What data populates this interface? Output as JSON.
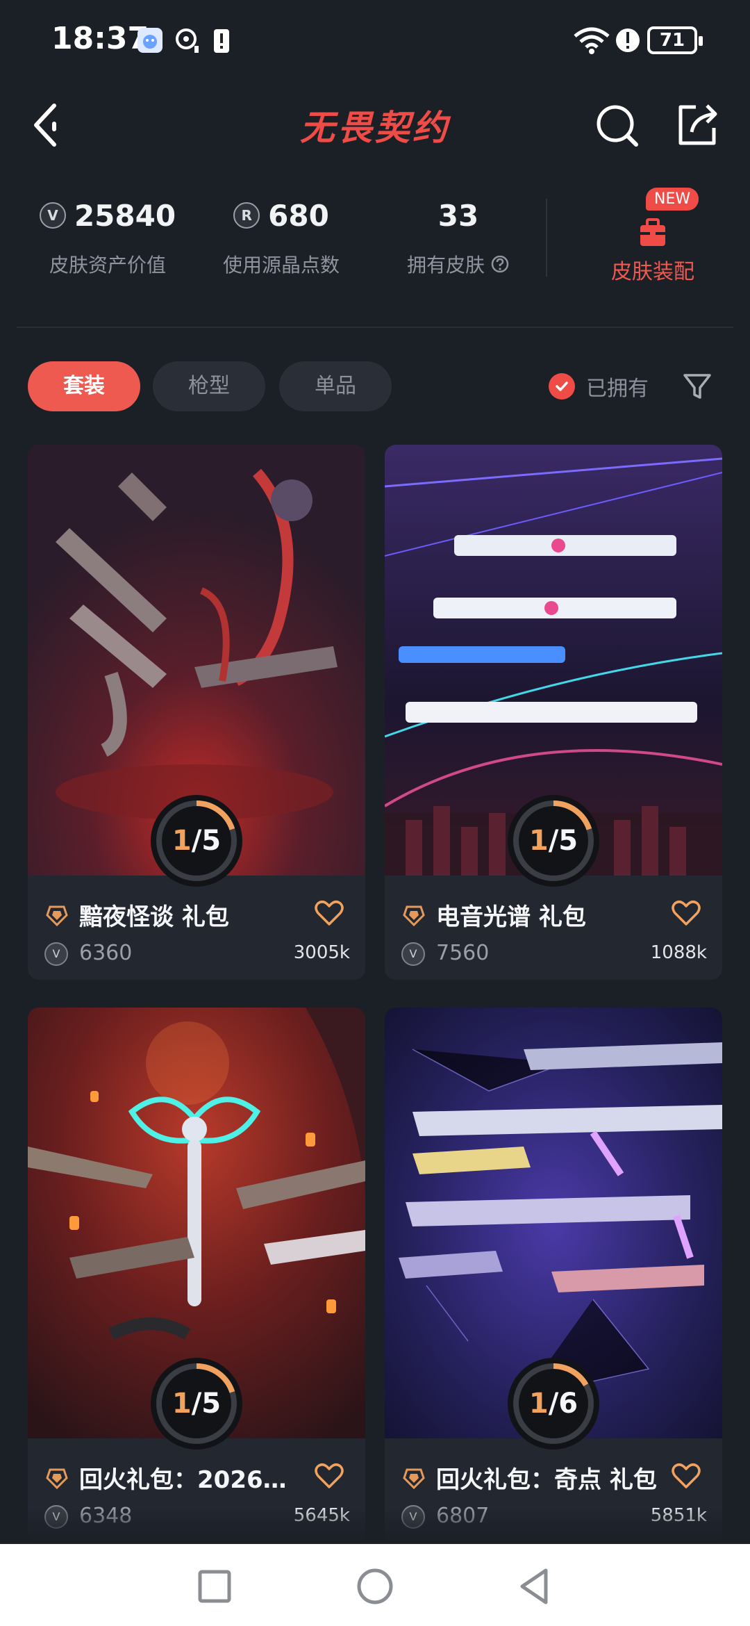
{
  "status_bar": {
    "time": "18:37",
    "battery": "71"
  },
  "header": {
    "title": "无畏契约"
  },
  "stats": {
    "asset_value": "25840",
    "asset_label": "皮肤资产价值",
    "points_value": "680",
    "points_label": "使用源晶点数",
    "skins_value": "33",
    "skins_label": "拥有皮肤",
    "equip_label": "皮肤装配",
    "new_badge": "NEW"
  },
  "filters": {
    "tabs": [
      "套装",
      "枪型",
      "单品"
    ],
    "active_tab": "套装",
    "owned_label": "已拥有"
  },
  "bundles": [
    {
      "title": "黯夜怪谈 礼包",
      "price": "6360",
      "likes": "3005k",
      "owned": 1,
      "total": 5
    },
    {
      "title": "电音光谱 礼包",
      "price": "7560",
      "likes": "1088k",
      "owned": 1,
      "total": 5
    },
    {
      "title": "回火礼包：2026春...",
      "price": "6348",
      "likes": "5645k",
      "owned": 1,
      "total": 5
    },
    {
      "title": "回火礼包：奇点 礼包",
      "price": "6807",
      "likes": "5851k",
      "owned": 1,
      "total": 6
    }
  ],
  "colors": {
    "accent": "#ef4c47",
    "progress": "#f0a25e",
    "background": "#1b1f26"
  },
  "icons": {
    "back": "chevron-left-icon",
    "search": "search-icon",
    "share": "share-icon",
    "filter": "funnel-icon",
    "heart": "heart-icon",
    "tier": "tier-icon"
  }
}
